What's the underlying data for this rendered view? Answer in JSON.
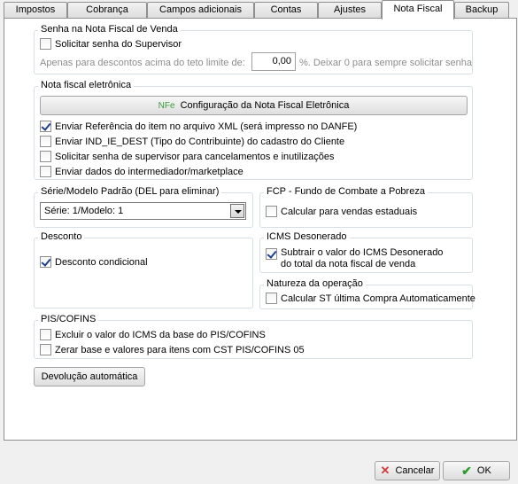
{
  "tabs": [
    {
      "label": "Impostos"
    },
    {
      "label": "Cobrança"
    },
    {
      "label": "Campos adicionais"
    },
    {
      "label": "Contas"
    },
    {
      "label": "Ajustes"
    },
    {
      "label": "Nota Fiscal"
    },
    {
      "label": "Backup"
    }
  ],
  "active_tab": "Nota Fiscal",
  "senha_group": {
    "legend": "Senha na Nota Fiscal de Venda",
    "solicitar_label": "Solicitar senha do Supervisor",
    "solicitar_checked": false,
    "desconto_prefix": "Apenas para descontos acima do teto limite de:",
    "desconto_value": "0,00",
    "desconto_suffix": "%. Deixar 0 para sempre solicitar senha"
  },
  "nfe_group": {
    "legend": "Nota fiscal eletrônica",
    "config_icon": "NFe",
    "config_button": "Configuração da Nota Fiscal Eletrônica",
    "options": [
      {
        "label": "Enviar Referência do item no arquivo XML (será impresso no DANFE)",
        "checked": true
      },
      {
        "label": "Enviar IND_IE_DEST (Tipo do Contribuinte) do cadastro do Cliente",
        "checked": false
      },
      {
        "label": "Solicitar senha de supervisor para cancelamentos e inutilizações",
        "checked": false
      },
      {
        "label": "Enviar dados do intermediador/marketplace",
        "checked": false
      }
    ]
  },
  "serie_group": {
    "legend": "Série/Modelo Padrão (DEL para eliminar)",
    "selected": "Série: 1/Modelo: 1"
  },
  "fcp_group": {
    "legend": "FCP - Fundo de Combate a Pobreza",
    "label": "Calcular para vendas estaduais",
    "checked": false
  },
  "desconto_group": {
    "legend": "Desconto",
    "label": "Desconto condicional",
    "checked": true
  },
  "icms_group": {
    "legend": "ICMS Desonerado",
    "label_line1": "Subtrair o valor do ICMS Desonerado",
    "label_line2": "do total da nota fiscal de venda",
    "checked": true
  },
  "natureza_group": {
    "legend": "Natureza da operação",
    "label": "Calcular ST última Compra Automaticamente",
    "checked": false
  },
  "pis_group": {
    "legend": "PIS/COFINS",
    "options": [
      {
        "label": "Excluir o valor do ICMS da base do PIS/COFINS",
        "checked": false
      },
      {
        "label": "Zerar base e valores para itens com CST PIS/COFINS 05",
        "checked": false
      }
    ]
  },
  "devolucao_button": "Devolução automática",
  "footer": {
    "cancel_label": "Cancelar",
    "ok_label": "OK"
  }
}
